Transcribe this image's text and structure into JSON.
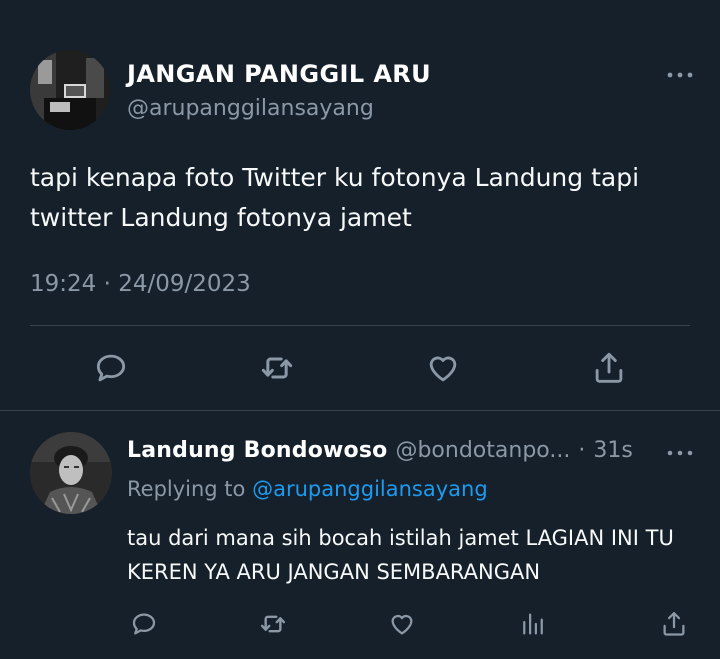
{
  "main_tweet": {
    "display_name": "JANGAN PANGGIL ARU",
    "handle": "@arupanggilansayang",
    "text": "tapi kenapa foto Twitter ku fotonya Landung tapi twitter Landung fotonya jamet",
    "time": "19:24",
    "separator": "·",
    "date": "24/09/2023",
    "actions": [
      "reply-icon",
      "retweet-icon",
      "like-icon",
      "share-icon"
    ]
  },
  "reply": {
    "display_name": "Landung Bondowoso",
    "handle": "@bondotanpo...",
    "separator": "·",
    "time": "31s",
    "replying_prefix": "Replying to",
    "replying_to": "@arupanggilansayang",
    "text": "tau dari mana sih bocah istilah jamet LAGIAN INI TU KEREN YA ARU JANGAN SEMBARANGAN",
    "actions": [
      "reply-icon",
      "retweet-icon",
      "like-icon",
      "views-icon",
      "share-icon"
    ]
  },
  "colors": {
    "background": "#15202b",
    "primary_text": "#ffffff",
    "secondary_text": "#8b98a5",
    "accent": "#1d9bf0",
    "divider": "#38444d"
  }
}
